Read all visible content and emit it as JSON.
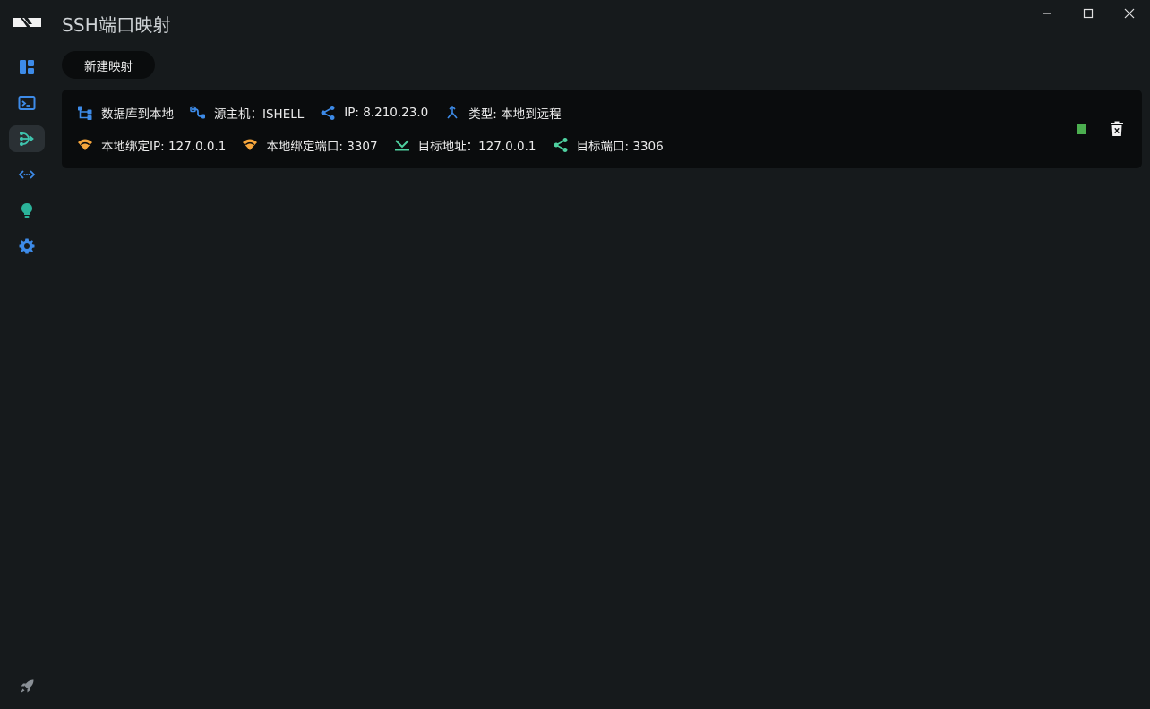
{
  "app": {
    "title": "SSH端口映射"
  },
  "toolbar": {
    "new_mapping_label": "新建映射"
  },
  "sidebar": {
    "items": [
      {
        "icon": "dashboard-icon",
        "color": "#3d8be8"
      },
      {
        "icon": "terminal-icon",
        "color": "#3d8be8"
      },
      {
        "icon": "port-forward-icon",
        "color": "#3fc6b0",
        "active": true
      },
      {
        "icon": "code-arrows-icon",
        "color": "#3d8be8"
      },
      {
        "icon": "lightbulb-icon",
        "color": "#2bb39a"
      },
      {
        "icon": "gear-icon",
        "color": "#3d8be8"
      },
      {
        "icon": "rocket-icon",
        "color": "#8a9096"
      }
    ]
  },
  "mapping": {
    "name": "数据库到本地",
    "source_host": "源主机：ISHELL",
    "ip": "IP: 8.210.23.0",
    "type": "类型: 本地到远程",
    "local_bind_ip": "本地绑定IP: 127.0.0.1",
    "local_bind_port": "本地绑定端口: 3307",
    "target_address": "目标地址：127.0.0.1",
    "target_port": "目标端口: 3306",
    "status_color": "#4caf50"
  },
  "colors": {
    "background": "#161a1c",
    "card": "#0a0c0d",
    "blue_icon": "#3d8be8",
    "orange_icon": "#f6a63c",
    "green_icon": "#4fd1a0"
  }
}
